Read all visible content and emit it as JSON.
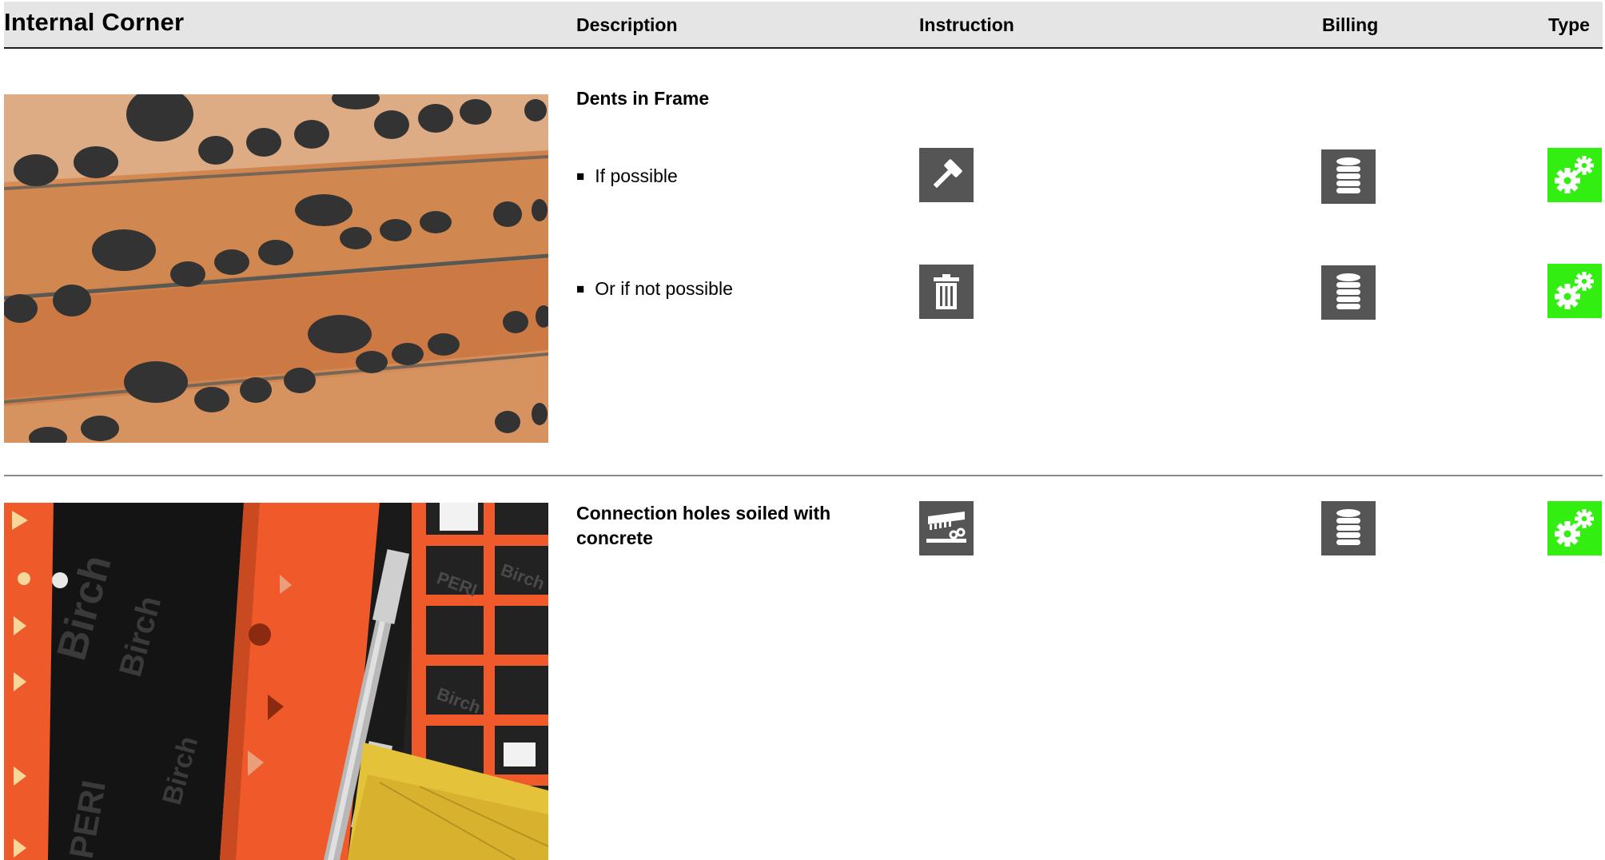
{
  "header": {
    "title": "Internal Corner",
    "columns": {
      "description": "Description",
      "instruction": "Instruction",
      "billing": "Billing",
      "type": "Type"
    }
  },
  "rows": [
    {
      "heading": "Dents in Frame",
      "options": [
        {
          "text": "If possible",
          "instruction_icon": "hammer-icon",
          "billing_icon": "coin-stack-icon",
          "type_icon": "gears-icon"
        },
        {
          "text": "Or if not possible",
          "instruction_icon": "trash-icon",
          "billing_icon": "coin-stack-icon",
          "type_icon": "gears-icon"
        }
      ]
    },
    {
      "heading_line1": "Connection holes soiled with",
      "heading_line2": "concrete",
      "instruction_icon": "cleaning-machine-icon",
      "billing_icon": "coin-stack-icon",
      "type_icon": "gears-icon"
    }
  ],
  "photo_labels": {
    "brand": "PERI",
    "panel_word": "Birch"
  },
  "colors": {
    "icon_gray": "#555555",
    "type_green": "#33ee11",
    "header_bg": "#e5e5e5"
  }
}
